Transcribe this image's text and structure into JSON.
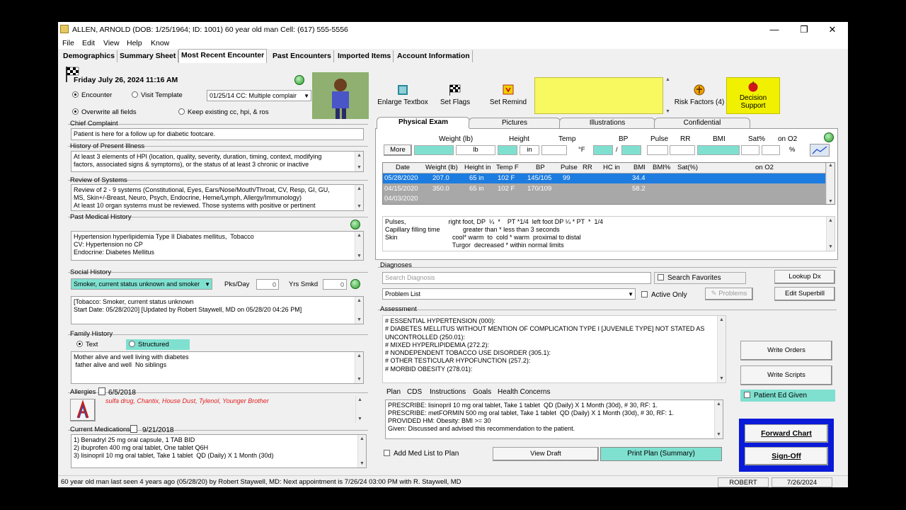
{
  "window": {
    "title": "ALLEN, ARNOLD (DOB: 1/25/1964; ID: 1001) 60 year old man Cell: (617) 555-5556",
    "minimize": "—",
    "maximize": "❐",
    "close": "✕"
  },
  "menu": [
    "File",
    "Edit",
    "View",
    "Help",
    "Know"
  ],
  "tabs": [
    "Demographics",
    "Summary Sheet",
    "Most Recent Encounter",
    "Past Encounters",
    "Imported Items",
    "Account Information"
  ],
  "encounter": {
    "date": "Friday July 26, 2024  11:16 AM",
    "opt_encounter": "Encounter",
    "opt_template": "Visit Template",
    "template_value": "01/25/14 CC: Multiple complair",
    "opt_overwrite": "Overwrite all fields",
    "opt_keep": "Keep existing cc, hpi, & ros"
  },
  "chief_complaint": {
    "label": "Chief Complaint",
    "text": "Patient is here for a follow up for diabetic footcare."
  },
  "hpi": {
    "label": "History of Present Illness",
    "text": "At least 3 elements of HPI (location, quality, severity, duration, timing, context, modifying\nfactors, associated signs & symptoms), or the status of at least 3 chronic or inactive"
  },
  "ros": {
    "label": "Review of Systems",
    "text": "Review of 2 - 9 systems (Constitutional, Eyes, Ears/Nose/Mouth/Throat, CV, Resp, GI, GU,\nMS, Skin+/-Breast, Neuro, Psych, Endocrine, Heme/Lymph, Allergy/Immunology)\nAt least 10 organ systems must be reviewed. Those systems with positive or pertinent"
  },
  "pmh": {
    "label": "Past Medical History",
    "text": "Hypertension hyperlipidemia Type II Diabates mellitus,  Tobacco\nCV: Hypertension no CP\nEndocrine: Diabetes Mellitus"
  },
  "social": {
    "label": "Social History",
    "select": "Smoker, current status unknown and smoker",
    "pks_label": "Pks/Day",
    "pks": "0",
    "yrs_label": "Yrs Smkd",
    "yrs": "0",
    "text": "[Tobacco: Smoker, current status unknown\nStart Date: 05/28/2020] [Updated by Robert Staywell, MD on 05/28/20 04:26 PM]"
  },
  "family": {
    "label": "Family History",
    "opt_text": "Text",
    "opt_structured": "Structured",
    "text": "Mother alive and well living with diabetes\n father alive and well  No siblings"
  },
  "allergies": {
    "label": "Allergies",
    "date": "6/5/2018",
    "text": "sulfa drug, Chantix, House Dust, Tylenol, Younger Brother"
  },
  "medications": {
    "label": "Current Medications",
    "date": "9/21/2018",
    "text": "1) Benadryl 25 mg oral capsule, 1 TAB BID\n2) ibuprofen 400 mg oral tablet, One tablet Q6H\n3) lisinopril 10 mg oral tablet, Take 1 tablet  QD (Daily) X 1 Month (30d)"
  },
  "toolbar": {
    "enlarge": "Enlarge Textbox",
    "flags": "Set Flags",
    "remind": "Set Remind",
    "risk": "Risk Factors (4)",
    "decision": "Decision\nSupport"
  },
  "panel_tabs": [
    "Physical Exam",
    "Pictures",
    "Illustrations",
    "Confidential"
  ],
  "vitals": {
    "labels": [
      "Weight (lb)",
      "Height",
      "Temp",
      "BP",
      "Pulse",
      "RR",
      "BMI",
      "Sat%",
      "on O2"
    ],
    "more": "More",
    "lb": "lb",
    "in": "in",
    "f": "°F",
    "slash": "/",
    "pct": "%"
  },
  "vitals_grid": {
    "headers": [
      "Date",
      "Weight (lb)",
      "Height in",
      "Temp F",
      "BP",
      "Pulse",
      "RR",
      "HC in",
      "BMI",
      "BMI%",
      "Sat(%)",
      "on O2"
    ],
    "rows": [
      [
        "05/28/2020",
        "207.0",
        "65 in",
        "102 F",
        "145/105",
        "99",
        "",
        "",
        "34.4",
        "",
        "",
        ""
      ],
      [
        "04/15/2020",
        "350.0",
        "65 in",
        "102 F",
        "170/109",
        "",
        "",
        "",
        "58.2",
        "",
        "",
        ""
      ],
      [
        "04/03/2020",
        "",
        "",
        "",
        "",
        "",
        "",
        "",
        "",
        "",
        "",
        ""
      ]
    ]
  },
  "exam": {
    "text": "Pulses,                        right foot, DP  ¼  *    PT *1/4  left foot DP ¼ * PT  *  1/4\nCapillary filling time             greater than * less than 3 seconds\nSkin                               cool* warm  to  cold * warm  proximal to distal\n                                      Turgor  decreased * within normal limits"
  },
  "diagnoses": {
    "label": "Diagnoses",
    "search_placeholder": "Search Diagnosis",
    "search_fav": "Search Favorites",
    "lookup": "Lookup Dx",
    "problem_list": "Problem List",
    "active_only": "Active Only",
    "problems": "Problems",
    "superbill": "Edit Superbill"
  },
  "assessment": {
    "label": "Assessment",
    "text": "# ESSENTIAL HYPERTENSION (000):\n# DIABETES MELLITUS WITHOUT MENTION OF COMPLICATION TYPE I [JUVENILE TYPE] NOT STATED AS\nUNCONTROLLED (250.01):\n# MIXED HYPERLIPIDEMIA (272.2):\n# NONDEPENDENT TOBACCO USE DISORDER (305.1):\n# OTHER TESTICULAR HYPOFUNCTION (257.2):\n# MORBID OBESITY (278.01):"
  },
  "plan_tabs": [
    "Plan",
    "CDS",
    "Instructions",
    "Goals",
    "Health Concerns"
  ],
  "plan": {
    "text": "PRESCRIBE: lisinopril 10 mg oral tablet, Take 1 tablet  QD (Daily) X 1 Month (30d), # 30, RF: 1.\nPRESCRIBE: metFORMIN 500 mg oral tablet, Take 1 tablet  QD (Daily) X 1 Month (30d), # 30, RF: 1.\nPROVIDED HM: Obesity: BMI >= 30\nGiven: Discussed and advised this recommendation to the patient.",
    "add_med": "Add Med List to Plan",
    "view_draft": "View Draft",
    "print_plan": "Print Plan (Summary)"
  },
  "actions": {
    "write_orders": "Write Orders",
    "write_scripts": "Write Scripts",
    "patient_ed": "Patient Ed Given",
    "forward": "Forward Chart",
    "signoff": "Sign-Off"
  },
  "status": {
    "text": "60 year old man last seen 4 years ago (05/28/20) by Robert Staywell, MD: Next appointment is 7/26/24 03:00 PM with R. Staywell, MD",
    "user": "ROBERT",
    "date": "7/26/2024"
  }
}
